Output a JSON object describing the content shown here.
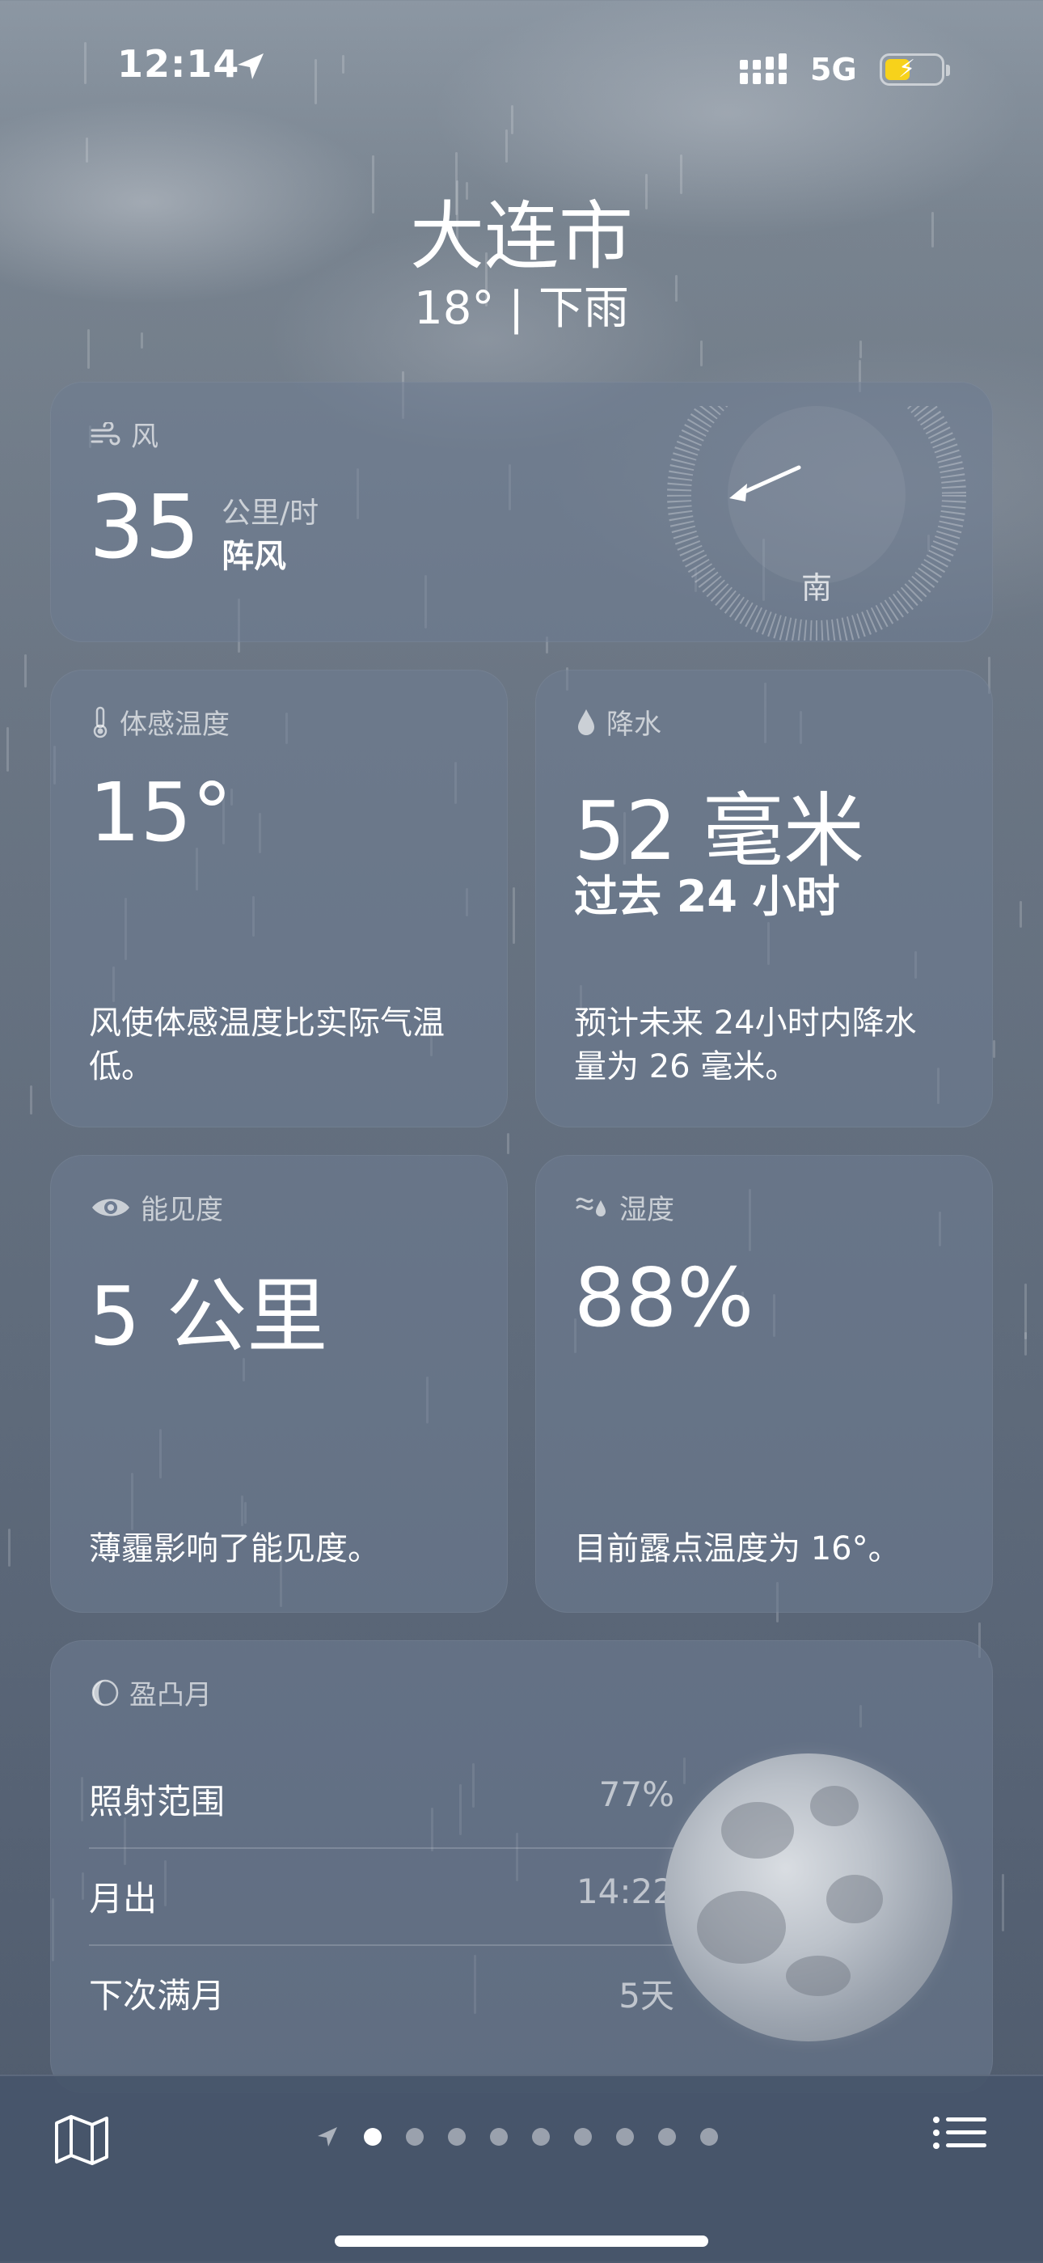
{
  "status_bar": {
    "time": "12:14",
    "network": "5G"
  },
  "header": {
    "city": "大连市",
    "condition": "18° | 下雨"
  },
  "wind": {
    "title": "风",
    "value": "35",
    "unit": "公里/时",
    "gust_label": "阵风",
    "compass_label": "南"
  },
  "feels_like": {
    "title": "体感温度",
    "value": "15°",
    "description": "风使体感温度比实际气温低。"
  },
  "precipitation": {
    "title": "降水",
    "value": "52 毫米",
    "subtitle": "过去 24 小时",
    "description": "预计未来 24小时内降水量为 26 毫米。"
  },
  "visibility": {
    "title": "能见度",
    "value": "5 公里",
    "description": "薄霾影响了能见度。"
  },
  "humidity": {
    "title": "湿度",
    "value": "88%",
    "description": "目前露点温度为 16°。"
  },
  "moon": {
    "title": "盈凸月",
    "rows": [
      {
        "label": "照射范围",
        "value": "77%"
      },
      {
        "label": "月出",
        "value": "14:22"
      },
      {
        "label": "下次满月",
        "value": "5天"
      }
    ]
  },
  "bottom_bar": {
    "page_count": 9,
    "active_index": 0
  }
}
